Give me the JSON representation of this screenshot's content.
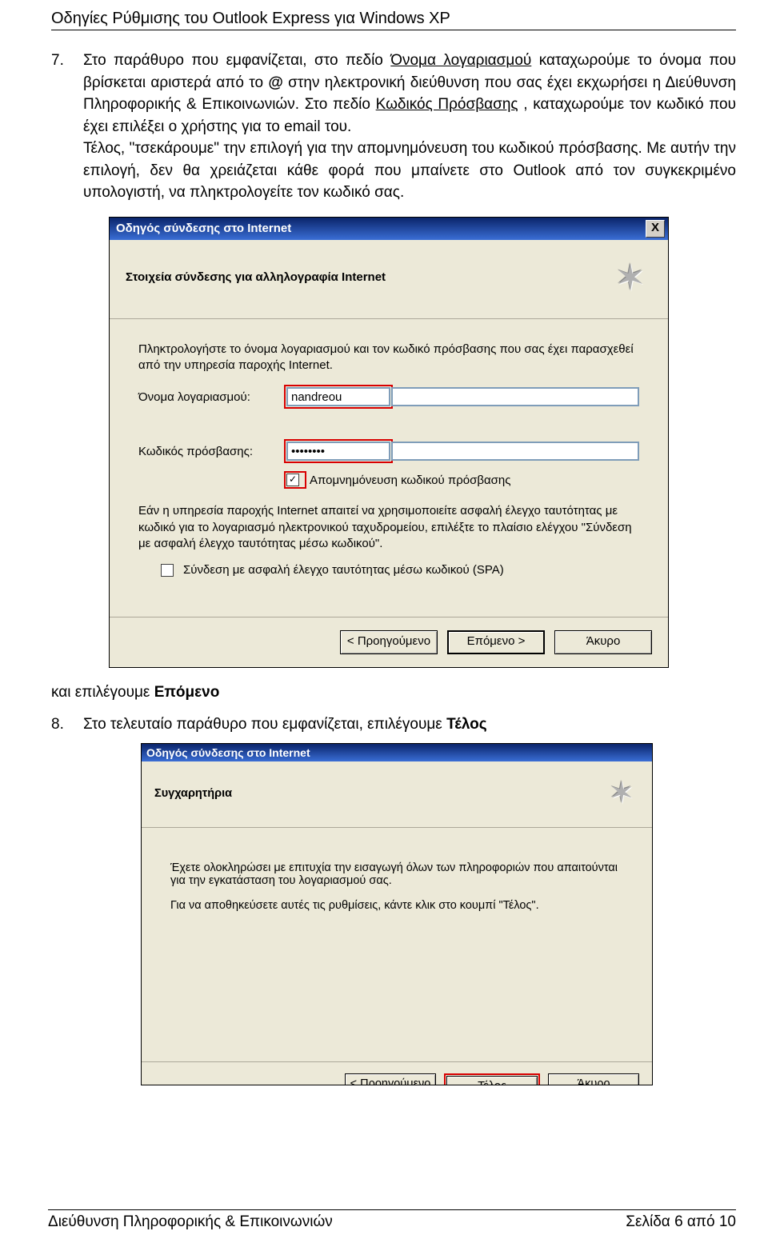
{
  "doc": {
    "title": "Οδηγίες Ρύθμισης του Outlook Express για Windows XP",
    "step7": {
      "num": "7.",
      "text_a": "Στο παράθυρο που εμφανίζεται, στο πεδίο ",
      "underline1": "Όνομα λογαριασμού",
      "text_b": " καταχωρούμε το όνομα που βρίσκεται αριστερά από το ",
      "bold_at": "@",
      "text_c": " στην ηλεκτρονική διεύθυνση που σας έχει εκχωρήσει η Διεύθυνση Πληροφορικής & Επικοινωνιών. Στο πεδίο ",
      "underline2": "Κωδικός Πρόσβασης",
      "text_d": ", καταχωρούμε τον κωδικό που έχει επιλέξει ο χρήστης για το email του.",
      "text_e": "Τέλος, \"τσεκάρουμε\" την επιλογή για την απομνημόνευση του κωδικού πρόσβασης. Με αυτήν την επιλογή, δεν θα χρειάζεται κάθε φορά που μπαίνετε στο Outlook από τον συγκεκριμένο υπολογιστή, να πληκτρολογείτε τον κωδικό σας."
    },
    "after_dialog": {
      "pre": "και επιλέγουμε ",
      "bold": "Επόμενο"
    },
    "step8": {
      "num": "8.",
      "text_a": "Στο τελευταίο παράθυρο που εμφανίζεται, επιλέγουμε ",
      "bold": "Τέλος"
    },
    "footer": {
      "left": "Διεύθυνση Πληροφορικής & Επικοινωνιών",
      "right": "Σελίδα 6 από 10"
    }
  },
  "dialog1": {
    "title": "Οδηγός σύνδεσης στο Internet",
    "header": "Στοιχεία σύνδεσης για αλληλογραφία Internet",
    "instr": "Πληκτρολογήστε το όνομα λογαριασμού και τον κωδικό πρόσβασης που σας έχει παρασχεθεί από την υπηρεσία παροχής Internet.",
    "account_label": "Όνομα λογαριασμού:",
    "account_value": "nandreou",
    "password_label": "Κωδικός πρόσβασης:",
    "password_value": "••••••••",
    "remember_label": "Απομνημόνευση κωδικού πρόσβασης",
    "remember_checked": "✓",
    "spa_text": "Εάν η υπηρεσία παροχής Internet απαιτεί να χρησιμοποιείτε ασφαλή έλεγχο ταυτότητας με κωδικό για το λογαριασμό ηλεκτρονικού ταχυδρομείου, επιλέξτε το πλαίσιο ελέγχου \"Σύνδεση με ασφαλή έλεγχο ταυτότητας μέσω κωδικού\".",
    "spa_checkbox_label": "Σύνδεση με ασφαλή έλεγχο ταυτότητας μέσω κωδικού (SPA)",
    "btn_back": "< Προηγούμενο",
    "btn_next": "Επόμενο >",
    "btn_cancel": "Άκυρο",
    "close_x": "X"
  },
  "dialog2": {
    "title": "Οδηγός σύνδεσης στο Internet",
    "header": "Συγχαρητήρια",
    "text1": "Έχετε ολοκληρώσει με επιτυχία την εισαγωγή όλων των πληροφοριών που απαιτούνται για την εγκατάσταση του λογαριασμού σας.",
    "text2": "Για να αποθηκεύσετε αυτές τις ρυθμίσεις, κάντε κλικ στο κουμπί \"Τέλος\".",
    "btn_back": "< Προηγούμενο",
    "btn_finish": "Τέλος",
    "btn_cancel": "Άκυρο"
  }
}
